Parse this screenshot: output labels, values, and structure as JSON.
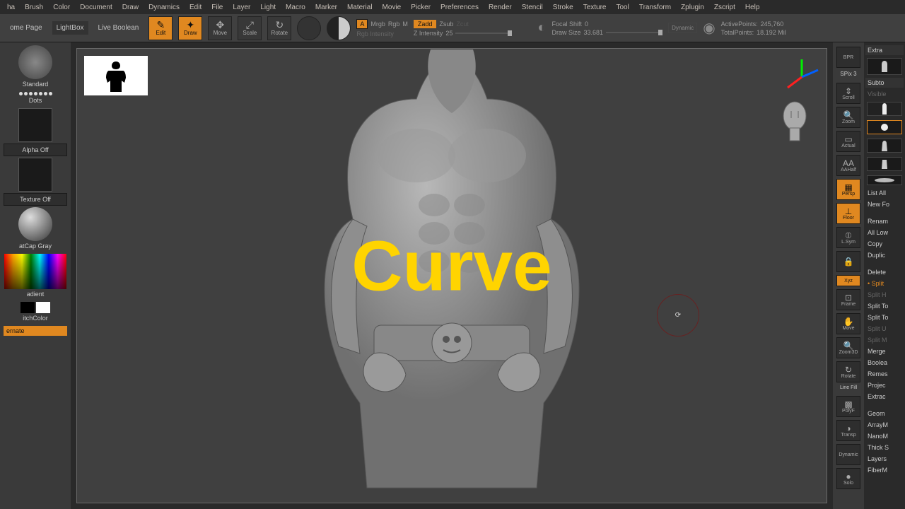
{
  "menu": [
    "ha",
    "Brush",
    "Color",
    "Document",
    "Draw",
    "Dynamics",
    "Edit",
    "File",
    "Layer",
    "Light",
    "Macro",
    "Marker",
    "Material",
    "Movie",
    "Picker",
    "Preferences",
    "Render",
    "Stencil",
    "Stroke",
    "Texture",
    "Tool",
    "Transform",
    "Zplugin",
    "Zscript",
    "Help"
  ],
  "toolbar": {
    "home": "ome Page",
    "lightbox": "LightBox",
    "liveboolean": "Live Boolean",
    "edit": "Edit",
    "draw": "Draw",
    "move": "Move",
    "scale": "Scale",
    "rotate": "Rotate",
    "a_btn": "A",
    "mrgb": "Mrgb",
    "rgb": "Rgb",
    "m": "M",
    "rgbint": "Rgb Intensity",
    "zadd": "Zadd",
    "zsub": "Zsub",
    "zcut": "Zcut",
    "zint_label": "Z Intensity",
    "zint_val": "25",
    "focal_label": "Focal Shift",
    "focal_val": "0",
    "drawsize_label": "Draw Size",
    "drawsize_val": "33.681",
    "dynamic": "Dynamic",
    "active_label": "ActivePoints:",
    "active_val": "245,760",
    "total_label": "TotalPoints:",
    "total_val": "18.192 Mil"
  },
  "left": {
    "brush": "Standard",
    "stroke": "Dots",
    "alpha": "Alpha Off",
    "texture": "Texture Off",
    "material": "atCap Gray",
    "gradient": "adient",
    "switch": "itchColor",
    "alternate": "ernate"
  },
  "overlay": "Curve",
  "right_icons": {
    "bpr": "BPR",
    "spix_lbl": "SPix",
    "spix_val": "3",
    "scroll": "Scroll",
    "zoom": "Zoom",
    "actual": "Actual",
    "aahalf": "AAHalf",
    "persp": "Persp",
    "floor": "Floor",
    "lsym": "L.Sym",
    "xyz": "Xyz",
    "frame": "Frame",
    "move": "Move",
    "zoom3d": "Zoom3D",
    "rotate": "Rotate",
    "polyf": "PolyF",
    "transp": "Transp",
    "dynamic": "Dynamic",
    "solo": "Solo",
    "linefill": "Line Fill"
  },
  "far_right": {
    "extra": "Extra",
    "subtool": "Subto",
    "visible": "Visible",
    "listall": "List All",
    "newfo": "New Fo",
    "rename": "Renam",
    "alllow": "All Low",
    "copy": "Copy",
    "duplicate": "Duplic",
    "delete": "Delete",
    "split": "Split",
    "splith": "Split H",
    "splitto": "Split To",
    "splitto2": "Split To",
    "splitu": "Split U",
    "splitm": "Split M",
    "merge": "Merge",
    "boolea": "Boolea",
    "remesh": "Remes",
    "project": "Projec",
    "extract": "Extrac",
    "geometry": "Geom",
    "arraym": "ArrayM",
    "nanom": "NanoM",
    "thick": "Thick S",
    "layers": "Layers",
    "fiberm": "FiberM"
  }
}
